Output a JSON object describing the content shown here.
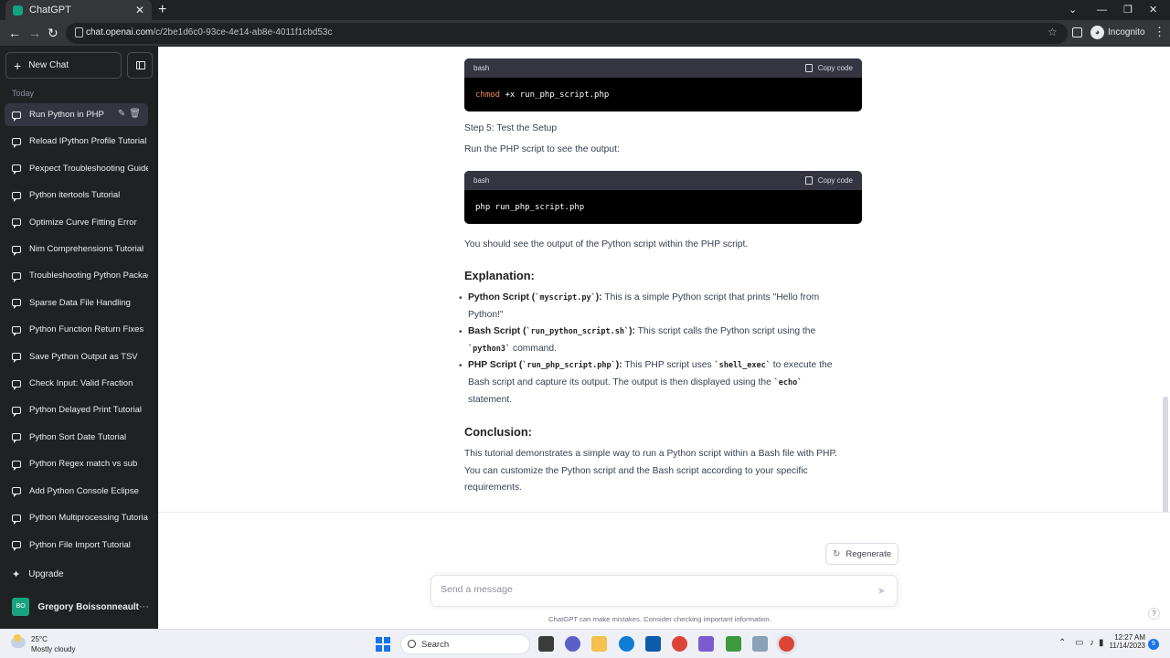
{
  "browser": {
    "tab_title": "ChatGPT",
    "url_domain": "chat.openai.com",
    "url_path": "/c/2be1d6c0-93ce-4e14-ab8e-4011f1cbd53c",
    "incognito_label": "Incognito"
  },
  "sidebar": {
    "new_chat_label": "New Chat",
    "section_label": "Today",
    "chats": [
      "Run Python in PHP",
      "Reload IPython Profile Tutorial",
      "Pexpect Troubleshooting Guide",
      "Python itertools Tutorial",
      "Optimize Curve Fitting Error",
      "Nim Comprehensions Tutorial",
      "Troubleshooting Python Packages",
      "Sparse Data File Handling",
      "Python Function Return Fixes",
      "Save Python Output as TSV",
      "Check Input: Valid Fraction",
      "Python Delayed Print Tutorial",
      "Python Sort Date Tutorial",
      "Python Regex match vs sub",
      "Add Python Console Eclipse",
      "Python Multiprocessing Tutorial",
      "Python File Import Tutorial"
    ],
    "upgrade_label": "Upgrade",
    "user_initials": "BO",
    "user_name": "Gregory Boissonneault"
  },
  "content": {
    "code1": {
      "lang": "bash",
      "copy_label": "Copy code",
      "cmd": "chmod",
      "rest": " +x run_php_script.php"
    },
    "step5": "Step 5: Test the Setup",
    "run_text": "Run the PHP script to see the output:",
    "code2": {
      "lang": "bash",
      "copy_label": "Copy code",
      "code": "php run_php_script.php"
    },
    "should_see": "You should see the output of the Python script within the PHP script.",
    "explanation_heading": "Explanation:",
    "items": [
      {
        "title_a": "Python Script (",
        "code": "`myscript.py`",
        "title_b": "):",
        "desc1": " This is a simple Python script that prints \"Hello from",
        "desc2": "Python!\""
      },
      {
        "title_a": "Bash Script (",
        "code": "`run_python_script.sh`",
        "title_b": "):",
        "desc1": " This script calls the Python script using the",
        "code2": "`python3`",
        "desc2": " command."
      },
      {
        "title_a": "PHP Script (",
        "code": "`run_php_script.php`",
        "title_b": "):",
        "desc1a": " This PHP script uses ",
        "code2": "`shell_exec`",
        "desc1b": " to execute the",
        "desc2a": "Bash script and capture its output. The output is then displayed using the ",
        "code3": "`echo`",
        "desc3": "statement."
      }
    ],
    "conclusion_heading": "Conclusion:",
    "conclusion_lines": [
      "This tutorial demonstrates a simple way to run a Python script within a Bash file with PHP.",
      "You can customize the Python script and the Bash script according to your specific",
      "requirements."
    ]
  },
  "composer": {
    "regenerate_label": "Regenerate",
    "placeholder": "Send a message",
    "disclaimer": "ChatGPT can make mistakes. Consider checking important information.",
    "help": "?"
  },
  "taskbar": {
    "temperature": "25°C",
    "condition": "Mostly cloudy",
    "search_label": "Search",
    "time": "12:27 AM",
    "date": "11/14/2023",
    "notification_count": "9"
  },
  "colors": {
    "sidebar_bg": "#202123",
    "accent": "#10a37f",
    "code_bg": "#000000"
  }
}
